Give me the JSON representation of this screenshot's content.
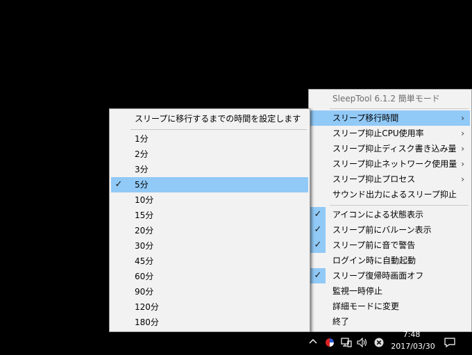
{
  "main_menu": {
    "header": "SleepTool 6.1.2 簡単モード",
    "items": [
      {
        "label": "スリープ移行時間",
        "submenu": true,
        "highlighted": true,
        "checked": false
      },
      {
        "label": "スリープ抑止CPU使用率",
        "submenu": true,
        "highlighted": false,
        "checked": false
      },
      {
        "label": "スリープ抑止ディスク書き込み量",
        "submenu": true,
        "highlighted": false,
        "checked": false
      },
      {
        "label": "スリープ抑止ネットワーク使用量",
        "submenu": true,
        "highlighted": false,
        "checked": false
      },
      {
        "label": "スリープ抑止プロセス",
        "submenu": true,
        "highlighted": false,
        "checked": false
      },
      {
        "label": "サウンド出力によるスリープ抑止",
        "submenu": false,
        "highlighted": false,
        "checked": false
      },
      {
        "label": "アイコンによる状態表示",
        "submenu": false,
        "highlighted": false,
        "checked": true
      },
      {
        "label": "スリープ前にバルーン表示",
        "submenu": false,
        "highlighted": false,
        "checked": true
      },
      {
        "label": "スリープ前に音で警告",
        "submenu": false,
        "highlighted": false,
        "checked": true
      },
      {
        "label": "ログイン時に自動起動",
        "submenu": false,
        "highlighted": false,
        "checked": false
      },
      {
        "label": "スリープ復帰時画面オフ",
        "submenu": false,
        "highlighted": false,
        "checked": true
      },
      {
        "label": "監視一時停止",
        "submenu": false,
        "highlighted": false,
        "checked": false
      },
      {
        "label": "詳細モードに変更",
        "submenu": false,
        "highlighted": false,
        "checked": false
      },
      {
        "label": "終了",
        "submenu": false,
        "highlighted": false,
        "checked": false
      }
    ],
    "arrow_glyph": "›",
    "check_glyph": "✓"
  },
  "sub_menu": {
    "header": "スリープに移行するまでの時間を設定します",
    "items": [
      {
        "label": "1分",
        "checked": false
      },
      {
        "label": "2分",
        "checked": false
      },
      {
        "label": "3分",
        "checked": false
      },
      {
        "label": "5分",
        "checked": true
      },
      {
        "label": "10分",
        "checked": false
      },
      {
        "label": "15分",
        "checked": false
      },
      {
        "label": "20分",
        "checked": false
      },
      {
        "label": "30分",
        "checked": false
      },
      {
        "label": "45分",
        "checked": false
      },
      {
        "label": "60分",
        "checked": false
      },
      {
        "label": "90分",
        "checked": false
      },
      {
        "label": "120分",
        "checked": false
      },
      {
        "label": "180分",
        "checked": false
      }
    ]
  },
  "taskbar": {
    "time": "7:48",
    "date": "2017/03/30",
    "tray_icons": [
      "chevron-up-icon",
      "sleeptool-icon",
      "network-icon",
      "volume-icon",
      "error-icon",
      "notification-icon"
    ]
  },
  "colors": {
    "menu_bg": "#f2f2f2",
    "highlight": "#91c9f7",
    "disabled_text": "#6d6d6d"
  }
}
